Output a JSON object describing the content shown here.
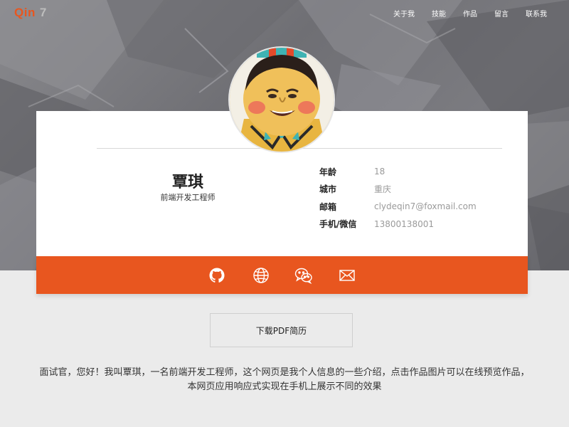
{
  "header": {
    "logo_primary": "Qin",
    "logo_secondary": "7",
    "nav": [
      "关于我",
      "技能",
      "作品",
      "留言",
      "联系我"
    ]
  },
  "profile": {
    "name": "覃琪",
    "role": "前端开发工程师",
    "info": [
      {
        "key": "年龄",
        "value": "18"
      },
      {
        "key": "城市",
        "value": "重庆"
      },
      {
        "key": "邮箱",
        "value": "clydeqin7@foxmail.com"
      },
      {
        "key": "手机/微信",
        "value": "13800138001"
      }
    ]
  },
  "social": {
    "icons": [
      "github-icon",
      "globe-icon",
      "wechat-icon",
      "mail-icon"
    ]
  },
  "download_label": "下载PDF简历",
  "intro": "面试官，您好！我叫覃琪，一名前端开发工程师，这个网页是我个人信息的一些介绍，点击作品图片可以在线预览作品，本网页应用响应式实现在手机上展示不同的效果",
  "colors": {
    "accent": "#e8561f",
    "hero_bg": "#75757a",
    "page_bg": "#ebebeb"
  }
}
